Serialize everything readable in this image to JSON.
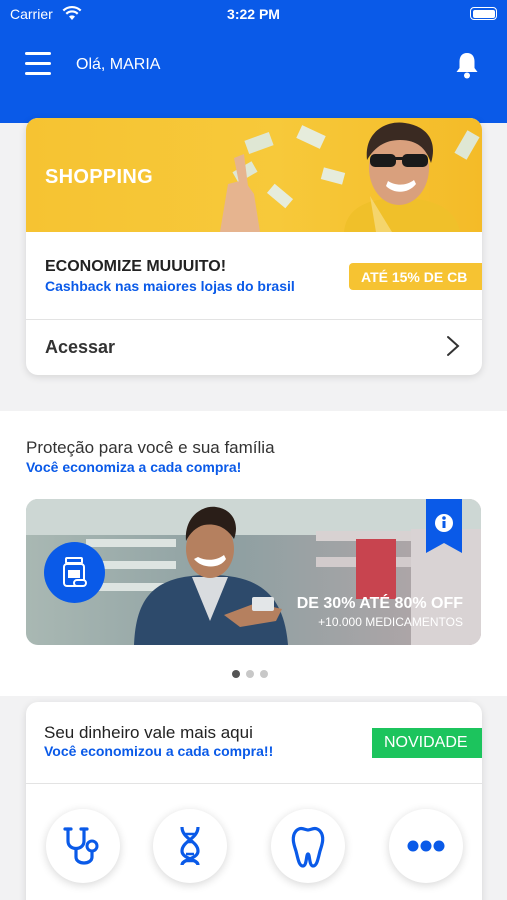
{
  "status_bar": {
    "carrier": "Carrier",
    "time": "3:22 PM"
  },
  "header": {
    "greeting": "Olá, MARIA",
    "color": "#0a5ae8"
  },
  "shopping_card": {
    "banner_title": "SHOPPING",
    "headline": "ECONOMIZE MUUUITO!",
    "subtitle": "Cashback nas maiores lojas do brasil",
    "badge": "ATÉ 15% DE CB",
    "action": "Acessar"
  },
  "protection": {
    "title": "Proteção para você e sua família",
    "subtitle": "Você economiza a cada compra!",
    "banner_headline": "DE 30% ATÉ 80% OFF",
    "banner_sub": "+10.000 MEDICAMENTOS",
    "carousel_dots": 3,
    "active_dot": 0
  },
  "money_card": {
    "title": "Seu dinheiro vale mais aqui",
    "subtitle": "Você economizou a cada compra!!",
    "badge": "NOVIDADE",
    "services": [
      {
        "icon": "stethoscope-icon",
        "label": ""
      },
      {
        "icon": "dna-icon",
        "label": ""
      },
      {
        "icon": "tooth-icon",
        "label": ""
      },
      {
        "icon": "more-icon",
        "label": ""
      }
    ]
  },
  "colors": {
    "brand_blue": "#0a5ae8",
    "yellow": "#f6c332",
    "green": "#1cc45d"
  }
}
